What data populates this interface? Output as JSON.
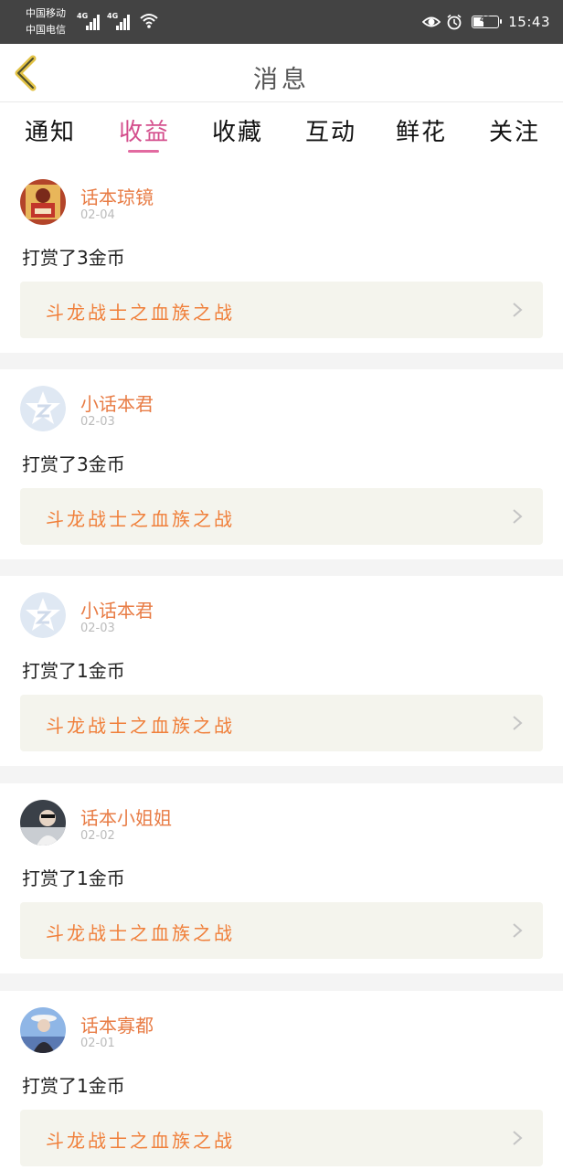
{
  "status_bar": {
    "carrier1": "中国移动",
    "carrier2": "中国电信",
    "net1": "4G",
    "net2": "4G",
    "battery": "41",
    "time": "15:43"
  },
  "header": {
    "title": "消息"
  },
  "tabs": [
    {
      "label": "通知",
      "active": false
    },
    {
      "label": "收益",
      "active": true
    },
    {
      "label": "收藏",
      "active": false
    },
    {
      "label": "互动",
      "active": false
    },
    {
      "label": "鲜花",
      "active": false
    },
    {
      "label": "关注",
      "active": false
    }
  ],
  "colors": {
    "accent": "#d44f8d",
    "name": "#e87c45",
    "book": "#f07f3a"
  },
  "items": [
    {
      "name": "话本琼镜",
      "date": "02-04",
      "message": "打赏了3金币",
      "book": "斗龙战士之血族之战",
      "avatar": "photo-avatar"
    },
    {
      "name": "小话本君",
      "date": "02-03",
      "message": "打赏了3金币",
      "book": "斗龙战士之血族之战",
      "avatar": "default-avatar"
    },
    {
      "name": "小话本君",
      "date": "02-03",
      "message": "打赏了1金币",
      "book": "斗龙战士之血族之战",
      "avatar": "default-avatar"
    },
    {
      "name": "话本小姐姐",
      "date": "02-02",
      "message": "打赏了1金币",
      "book": "斗龙战士之血族之战",
      "avatar": "photo-avatar"
    },
    {
      "name": "话本寡都",
      "date": "02-01",
      "message": "打赏了1金币",
      "book": "斗龙战士之血族之战",
      "avatar": "photo-avatar"
    }
  ]
}
